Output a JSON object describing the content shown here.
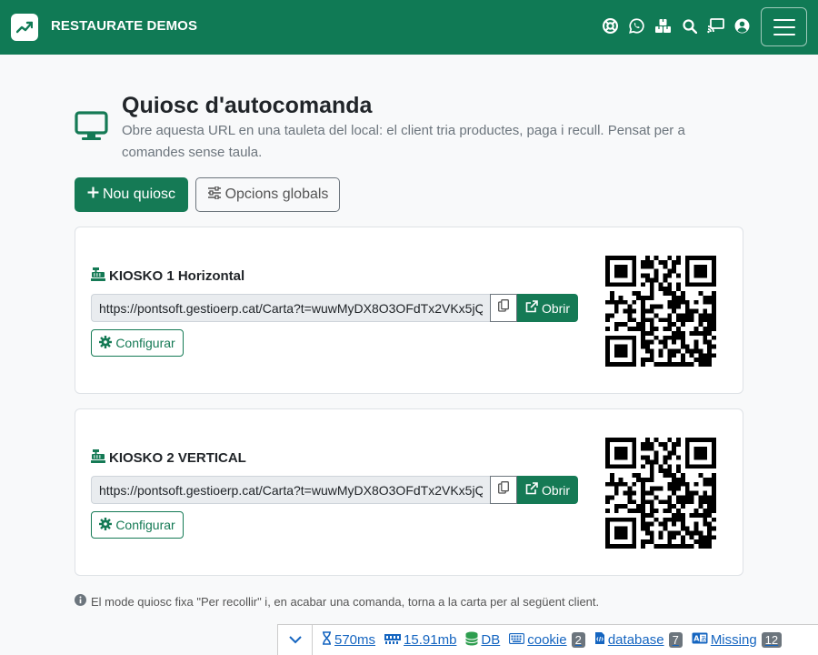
{
  "navbar": {
    "brand": "RESTAURATE DEMOS",
    "icons": [
      "lifebuoy-icon",
      "whatsapp-icon",
      "boxes-icon",
      "search-icon",
      "cast-icon",
      "user-icon",
      "menu-icon"
    ]
  },
  "header": {
    "title": "Quiosc d'autocomanda",
    "description": "Obre aquesta URL en una tauleta del local: el client tria productes, paga i recull. Pensat per a comandes sense taula."
  },
  "actions": {
    "new_label": "Nou quiosc",
    "options_label": "Opcions globals"
  },
  "kiosks": [
    {
      "name": "KIOSKO 1 Horizontal",
      "url": "https://pontsoft.gestioerp.cat/Carta?t=wuwMyDX8O3OFdTx2VKx5jQ...",
      "open_label": "Obrir",
      "config_label": "Configurar"
    },
    {
      "name": "KIOSKO 2 VERTICAL",
      "url": "https://pontsoft.gestioerp.cat/Carta?t=wuwMyDX8O3OFdTx2VKx5jQ...",
      "open_label": "Obrir",
      "config_label": "Configurar"
    }
  ],
  "footnote": "El mode quiosc fixa \"Per recollir\" i, en acabar una comanda, torna a la carta per al següent client.",
  "debugbar": {
    "time": "570ms",
    "memory": "15.91mb",
    "db": "DB",
    "cookie": "cookie",
    "cookie_count": "2",
    "database": "database",
    "database_count": "7",
    "missing": "Missing",
    "missing_count": "12"
  },
  "colors": {
    "primary": "#157a55",
    "navbar": "#107a55",
    "link": "#1565c0"
  }
}
